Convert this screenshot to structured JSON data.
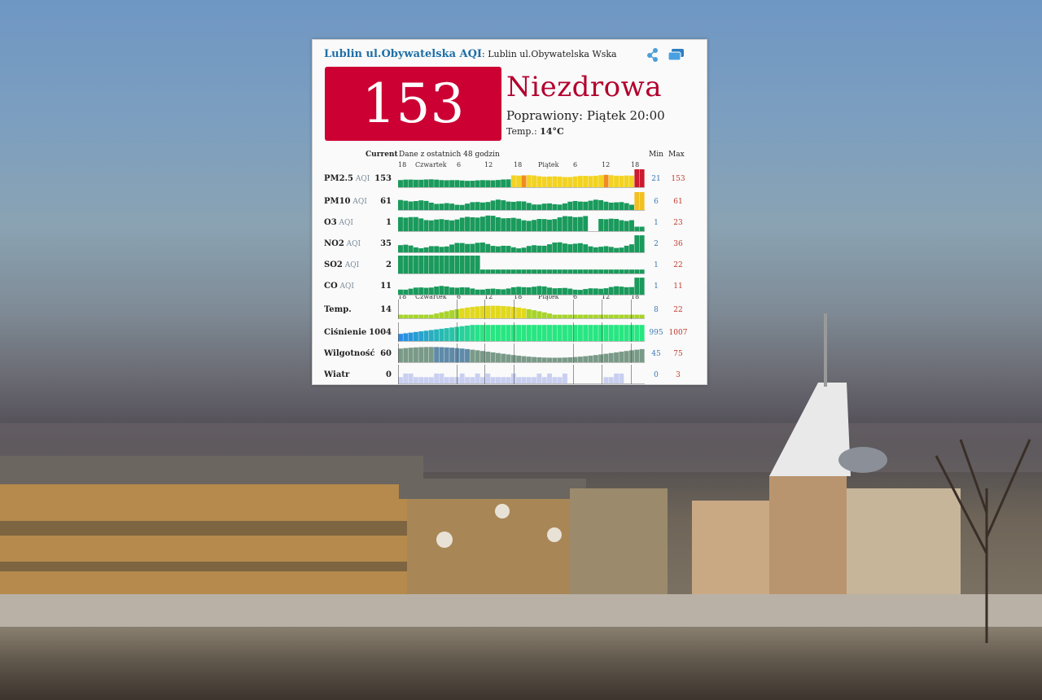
{
  "header": {
    "station_link": "Lublin ul.Obywatelska AQI",
    "station_desc": ": Lublin ul.Obywatelska Wskaźnik Jak"
  },
  "aqi": {
    "value": "153",
    "status": "Niezdrowa",
    "updated": "Poprawiony: Piątek 20:00",
    "temp_label": "Temp.:",
    "temp_value": "14°C",
    "color": "#cc0033"
  },
  "table": {
    "current_header": "Current",
    "history_header": "Dane z ostatnich 48 godzin",
    "min_header": "Min",
    "max_header": "Max",
    "axis_labels": [
      "18",
      "Czwartek",
      "6",
      "12",
      "18",
      "Piątek",
      "6",
      "12",
      "18"
    ]
  },
  "rows": [
    {
      "label": "PM2.5",
      "sub": "AQI",
      "current": "153",
      "min": "21",
      "max": "153",
      "style": "pm25",
      "level": 0.5
    },
    {
      "label": "PM10",
      "sub": "AQI",
      "current": "61",
      "min": "6",
      "max": "61",
      "style": "pm10",
      "level": 0.35
    },
    {
      "label": "O3",
      "sub": "AQI",
      "current": "1",
      "min": "1",
      "max": "23",
      "style": "o3",
      "level": 0.75
    },
    {
      "label": "NO2",
      "sub": "AQI",
      "current": "35",
      "min": "2",
      "max": "36",
      "style": "no2",
      "level": 0.4
    },
    {
      "label": "SO2",
      "sub": "AQI",
      "current": "2",
      "min": "1",
      "max": "22",
      "style": "so2",
      "level": 0.2
    },
    {
      "label": "CO",
      "sub": "AQI",
      "current": "11",
      "min": "1",
      "max": "11",
      "style": "co",
      "level": 0.4
    },
    {
      "label": "Temp.",
      "sub": "",
      "current": "14",
      "min": "8",
      "max": "22",
      "style": "temp",
      "level": 0.45
    },
    {
      "label": "Ciśnienie",
      "sub": "",
      "current": "1004",
      "min": "995",
      "max": "1007",
      "style": "pres",
      "level": 0.8
    },
    {
      "label": "Wilgotność",
      "sub": "",
      "current": "60",
      "min": "45",
      "max": "75",
      "style": "hum",
      "level": 0.75
    },
    {
      "label": "Wiatr",
      "sub": "",
      "current": "0",
      "min": "0",
      "max": "3",
      "style": "wind",
      "level": 0.15
    }
  ],
  "icons": {
    "share": "share-icon",
    "window": "window-icon"
  }
}
